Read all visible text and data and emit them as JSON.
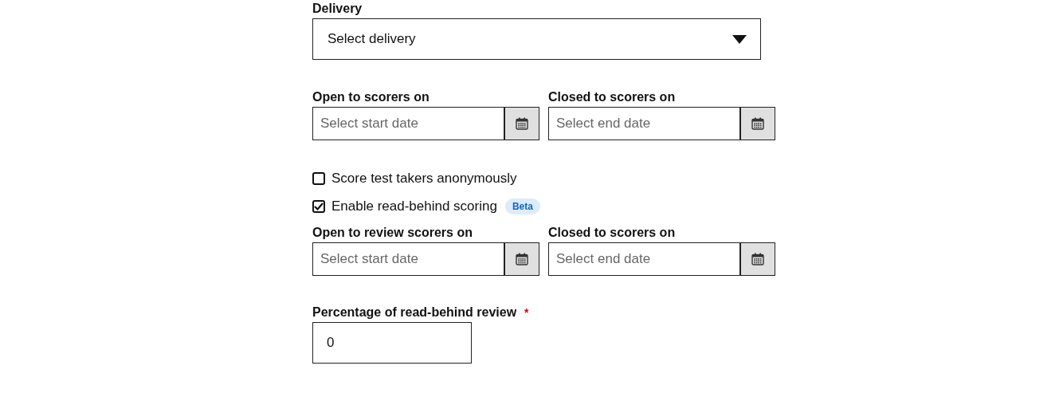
{
  "delivery": {
    "label": "Delivery",
    "placeholder": "Select delivery"
  },
  "scoring_dates": [
    {
      "label": "Open to scorers on",
      "placeholder": "Select start date"
    },
    {
      "label": "Closed to scorers on",
      "placeholder": "Select end date"
    }
  ],
  "options": [
    {
      "label": "Score test takers anonymously",
      "checked": false
    },
    {
      "label": "Enable read-behind scoring",
      "checked": true,
      "badge": "Beta"
    }
  ],
  "review_dates": [
    {
      "label": "Open to review scorers on",
      "placeholder": "Select start date"
    },
    {
      "label": "Closed to scorers on",
      "placeholder": "Select end date"
    }
  ],
  "percentage": {
    "label": "Percentage of read-behind review",
    "required_mark": "*",
    "value": "0"
  }
}
